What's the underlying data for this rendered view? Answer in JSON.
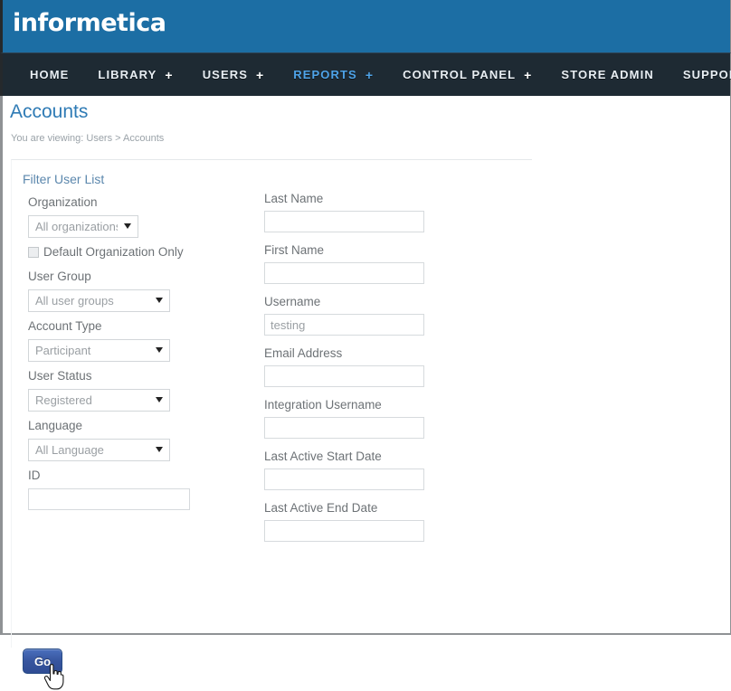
{
  "header": {
    "logo_text": "informetica",
    "brand_color": "#1c6ea4"
  },
  "nav": {
    "active_color": "#4ea3e8",
    "items": [
      {
        "label": "HOME",
        "plus": "",
        "active": false
      },
      {
        "label": "LIBRARY",
        "plus": "+",
        "active": false
      },
      {
        "label": "USERS",
        "plus": "+",
        "active": false
      },
      {
        "label": "REPORTS",
        "plus": "+",
        "active": true
      },
      {
        "label": "CONTROL PANEL",
        "plus": "+",
        "active": false
      },
      {
        "label": "STORE ADMIN",
        "plus": "",
        "active": false
      },
      {
        "label": "SUPPORT",
        "plus": "+",
        "active": false
      }
    ]
  },
  "page": {
    "title": "Accounts",
    "breadcrumb": "You are viewing: Users > Accounts"
  },
  "filter_panel": {
    "heading": "Filter User List",
    "left_fields": {
      "organization": {
        "label": "Organization",
        "value": "All organizations",
        "options": [
          "All organizations"
        ]
      },
      "default_org_only": {
        "label": "Default Organization Only",
        "checked": false
      },
      "user_group": {
        "label": "User Group",
        "value": "All user groups",
        "options": [
          "All user groups"
        ]
      },
      "account_type": {
        "label": "Account Type",
        "value": "Participant",
        "options": [
          "Participant"
        ]
      },
      "user_status": {
        "label": "User Status",
        "value": "Registered",
        "options": [
          "Registered"
        ]
      },
      "language": {
        "label": "Language",
        "value": "All Language",
        "options": [
          "All Language"
        ]
      },
      "id": {
        "label": "ID",
        "value": "",
        "placeholder": ""
      }
    },
    "right_fields": [
      {
        "label": "Last Name",
        "value": "",
        "placeholder": ""
      },
      {
        "label": "First Name",
        "value": "",
        "placeholder": ""
      },
      {
        "label": "Username",
        "value": "testing",
        "placeholder": ""
      },
      {
        "label": "Email Address",
        "value": "",
        "placeholder": ""
      },
      {
        "label": "Integration Username",
        "value": "",
        "placeholder": ""
      },
      {
        "label": "Last Active Start Date",
        "value": "",
        "placeholder": ""
      },
      {
        "label": "Last Active End Date",
        "value": "",
        "placeholder": ""
      }
    ]
  },
  "actions": {
    "go_label": "Go"
  }
}
